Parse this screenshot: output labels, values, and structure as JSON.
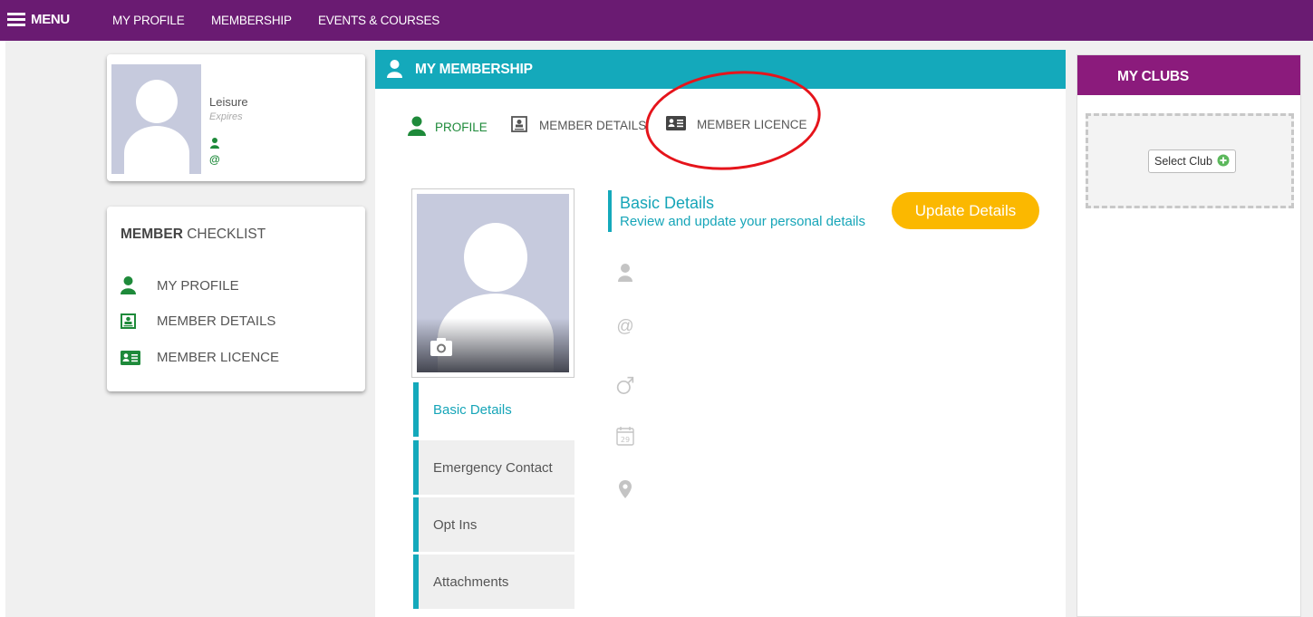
{
  "topnav": {
    "menu_label": "MENU",
    "links": [
      "MY PROFILE",
      "MEMBERSHIP",
      "EVENTS & COURSES"
    ]
  },
  "profile_card": {
    "membership_type": "Leisure",
    "expires_label": "Expires",
    "person_icon": "person-icon",
    "email_icon": "at-icon"
  },
  "checklist": {
    "title_bold": "MEMBER",
    "title_rest": " CHECKLIST",
    "items": [
      {
        "label": "MY PROFILE",
        "icon": "person-icon"
      },
      {
        "label": "MEMBER DETAILS",
        "icon": "member-details-icon"
      },
      {
        "label": "MEMBER LICENCE",
        "icon": "licence-card-icon"
      }
    ]
  },
  "membership": {
    "title": "MY MEMBERSHIP",
    "tabs": [
      {
        "label": "PROFILE",
        "icon": "person-icon",
        "active": true
      },
      {
        "label": "MEMBER DETAILS",
        "icon": "member-details-icon",
        "active": false
      },
      {
        "label": "MEMBER LICENCE",
        "icon": "licence-card-icon",
        "active": false
      }
    ],
    "side_tabs": [
      "Basic Details",
      "Emergency Contact",
      "Opt Ins",
      "Attachments"
    ],
    "basic_details": {
      "title": "Basic Details",
      "subtitle": "Review and update your personal details",
      "update_button": "Update Details",
      "field_icons": [
        "person-icon",
        "at-icon",
        "male-icon",
        "calendar-icon",
        "location-pin-icon"
      ],
      "calendar_day": "29"
    }
  },
  "clubs": {
    "title": "MY CLUBS",
    "select_button": "Select Club"
  },
  "colors": {
    "topbar": "#6a1b72",
    "membership_header": "#14a9bb",
    "clubs_header": "#8b1b7c",
    "update_button": "#fbb800",
    "green": "#1e8a3a",
    "annotation": "#e5141b"
  }
}
